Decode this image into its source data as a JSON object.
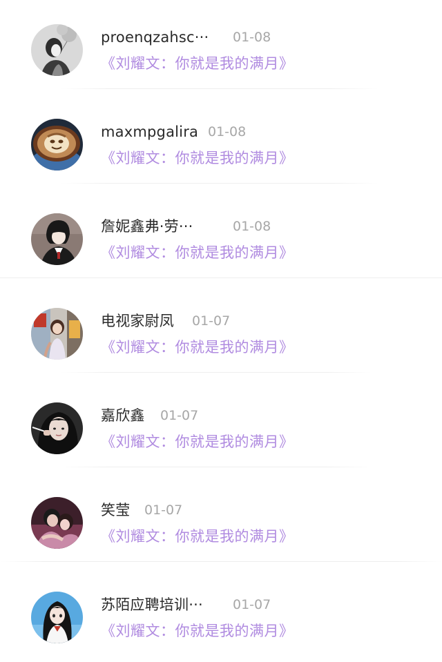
{
  "colors": {
    "background": "#ffffff",
    "name_text": "#2a2a2a",
    "date_text": "#a7a7a7",
    "song_link": "#b08be0",
    "divider": "#eeeeee"
  },
  "items": [
    {
      "name": "proenqzahsc···",
      "date": "01-08",
      "song": "《刘耀文：你就是我的满月》",
      "avatar": "girl-with-balloons-avatar"
    },
    {
      "name": "maxmpgalira",
      "date": "01-08",
      "song": "《刘耀文：你就是我的满月》",
      "avatar": "latte-art-avatar"
    },
    {
      "name": "詹妮鑫弗·劳···",
      "date": "01-08",
      "song": "《刘耀文：你就是我的满月》",
      "avatar": "anime-boy-avatar"
    },
    {
      "name": "电视家尉凤",
      "date": "01-07",
      "song": "《刘耀文：你就是我的满月》",
      "avatar": "street-girl-avatar"
    },
    {
      "name": "嘉欣鑫",
      "date": "01-07",
      "song": "《刘耀文：你就是我的满月》",
      "avatar": "dark-hair-girl-avatar"
    },
    {
      "name": "笑莹",
      "date": "01-07",
      "song": "《刘耀文：你就是我的满月》",
      "avatar": "couple-photo-avatar"
    },
    {
      "name": "苏陌应聘培训···",
      "date": "01-07",
      "song": "《刘耀文：你就是我的满月》",
      "avatar": "anime-girl-avatar"
    }
  ]
}
